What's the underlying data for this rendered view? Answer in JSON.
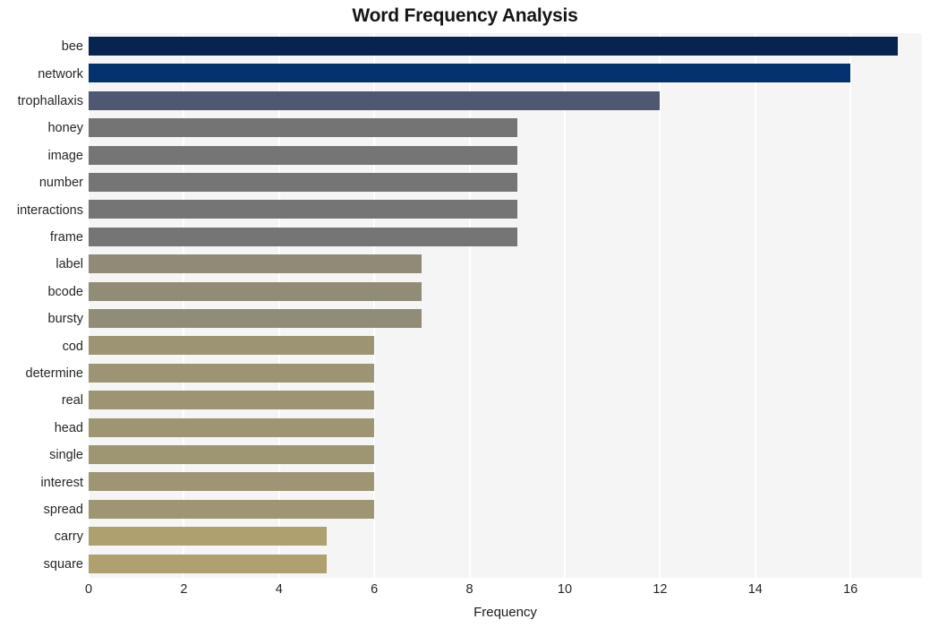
{
  "chart_data": {
    "type": "bar",
    "orientation": "horizontal",
    "title": "Word Frequency Analysis",
    "xlabel": "Frequency",
    "ylabel": "",
    "categories": [
      "bee",
      "network",
      "trophallaxis",
      "honey",
      "image",
      "number",
      "interactions",
      "frame",
      "label",
      "bcode",
      "bursty",
      "cod",
      "determine",
      "real",
      "head",
      "single",
      "interest",
      "spread",
      "carry",
      "square"
    ],
    "values": [
      17,
      16,
      12,
      9,
      9,
      9,
      9,
      9,
      7,
      7,
      7,
      6,
      6,
      6,
      6,
      6,
      6,
      6,
      5,
      5
    ],
    "bar_colors": [
      "#072350",
      "#04326e",
      "#4f5871",
      "#747474",
      "#757575",
      "#757575",
      "#757575",
      "#757575",
      "#908b76",
      "#918c77",
      "#918c77",
      "#9d9473",
      "#9d9473",
      "#9d9473",
      "#9e9572",
      "#9e9572",
      "#9e9572",
      "#9e9572",
      "#aea16f",
      "#aea16f"
    ],
    "xlim": [
      0,
      17.5
    ],
    "xticks": [
      0,
      2,
      4,
      6,
      8,
      10,
      12,
      14,
      16
    ],
    "xtick_labels": [
      "0",
      "2",
      "4",
      "6",
      "8",
      "10",
      "12",
      "14",
      "16"
    ],
    "grid": true,
    "grid_axis": "x",
    "grid_color": "#ffffff",
    "plot_background": "#f5f5f5",
    "figure_background": "#ffffff",
    "legend": null
  }
}
